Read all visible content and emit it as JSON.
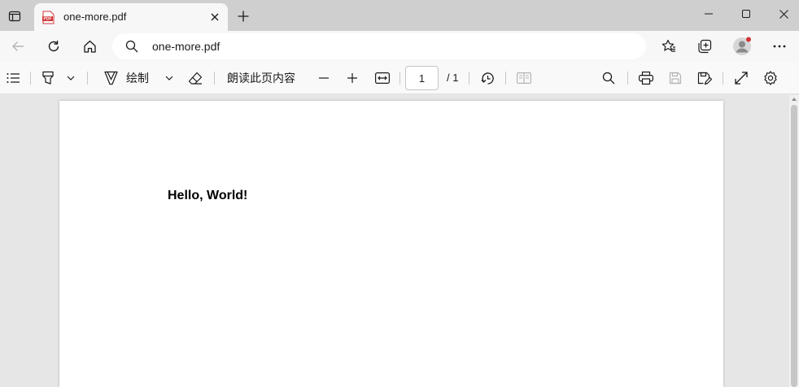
{
  "browser": {
    "tab": {
      "title": "one-more.pdf",
      "favicon_text": "PDF"
    },
    "address": "one-more.pdf"
  },
  "pdf_toolbar": {
    "draw_label": "绘制",
    "read_aloud_label": "朗读此页内容",
    "current_page": "1",
    "total_pages": "/ 1"
  },
  "document": {
    "text": "Hello, World!"
  },
  "colors": {
    "tabstrip": "#cfcfcf",
    "toolbar": "#f7f7f7",
    "viewer_bg": "#e6e6e6",
    "avatar_badge": "#d13438"
  }
}
